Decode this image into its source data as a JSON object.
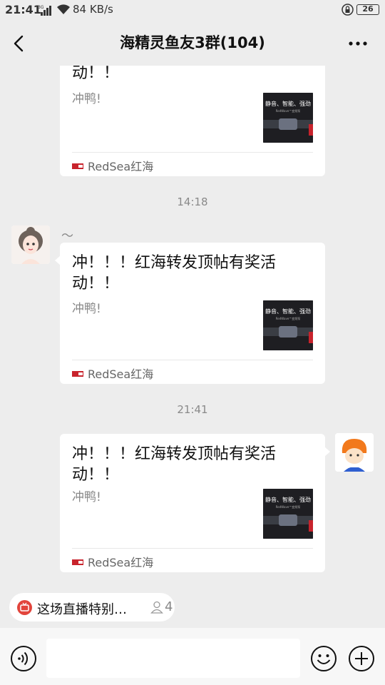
{
  "status": {
    "time": "21:41",
    "net_type": "3G",
    "speed": "84 KB/s",
    "battery": "26"
  },
  "header": {
    "title": "海精灵鱼友3群(104)"
  },
  "messages": [
    {
      "title": "动！！",
      "desc": "冲鸭!",
      "thumb_line1": "静音、智能、强劲",
      "thumb_line2": "RedWave™变频泵",
      "source": "RedSea红海"
    },
    {
      "time": "14:18",
      "nickname": "～",
      "title": "冲！！！红海转发顶帖有奖活动！！",
      "desc": "冲鸭!",
      "thumb_line1": "静音、智能、强劲",
      "thumb_line2": "RedWave™变频泵",
      "source": "RedSea红海"
    },
    {
      "time": "21:41",
      "title": "冲！！！红海转发顶帖有奖活动！！",
      "desc": "冲鸭!",
      "thumb_line1": "静音、智能、强劲",
      "thumb_line2": "RedWave™变频泵",
      "source": "RedSea红海"
    }
  ],
  "live": {
    "text": "这场直播特别…",
    "viewers": "4"
  },
  "input": {
    "value": ""
  },
  "icons": {
    "back": "back-arrow-icon",
    "more": "more-dots-icon",
    "voice": "voice-input-icon",
    "emoji": "emoji-icon",
    "plus": "plus-icon",
    "live": "live-tv-icon",
    "person": "person-icon"
  },
  "colors": {
    "bg": "#ededed",
    "bubble": "#ffffff",
    "live_red": "#e2453c",
    "brand_red": "#c8232c"
  }
}
